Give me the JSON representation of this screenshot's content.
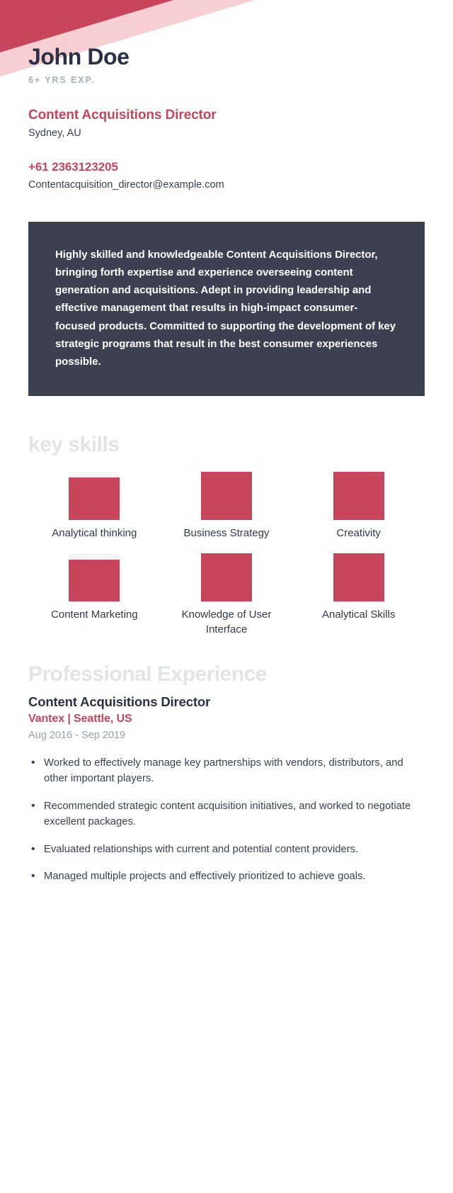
{
  "theme": {
    "accent": "#C9455C",
    "accent_light": "#F7CFD2",
    "panel_dark": "#3C4051",
    "ghost_heading": "#E2E4E6",
    "muted_text": "#9AA0AD",
    "body_text": "#3A4052",
    "page_background": "#FFFFFF"
  },
  "header": {
    "full_name": "John Doe",
    "years_experience": "6+ YRS EXP.",
    "role_title": "Content Acquisitions Director",
    "location": "Sydney, AU",
    "phone": "+61 2363123205",
    "email": "Contentacquisition_director@example.com"
  },
  "summary": {
    "text": "Highly skilled and knowledgeable Content Acquisitions Director, bringing forth expertise and experience overseeing content generation and acquisitions. Adept in providing leadership and effective management that results in high-impact consumer-focused products. Committed to supporting the development of key strategic programs that result in the best consumer experiences possible."
  },
  "skills": {
    "heading": "key skills",
    "items": [
      {
        "label": "Analytical thinking",
        "fill_percent": 88
      },
      {
        "label": "Business Strategy",
        "fill_percent": 100
      },
      {
        "label": "Creativity",
        "fill_percent": 100
      },
      {
        "label": "Content Marketing",
        "fill_percent": 88
      },
      {
        "label": "Knowledge of User Interface",
        "fill_percent": 100
      },
      {
        "label": "Analytical Skills",
        "fill_percent": 100
      }
    ]
  },
  "experience": {
    "heading": "Professional Experience",
    "jobs": [
      {
        "title": "Content Acquisitions Director",
        "company": "Vantex | Seattle, US",
        "dates": "Aug 2016 - Sep 2019",
        "bullets": [
          "Worked to effectively manage key partnerships with vendors, distributors, and other important players.",
          "Recommended strategic content acquisition initiatives, and worked to negotiate excellent packages.",
          "Evaluated relationships with current and potential content providers.",
          "Managed multiple projects and effectively prioritized to achieve goals."
        ]
      }
    ]
  }
}
